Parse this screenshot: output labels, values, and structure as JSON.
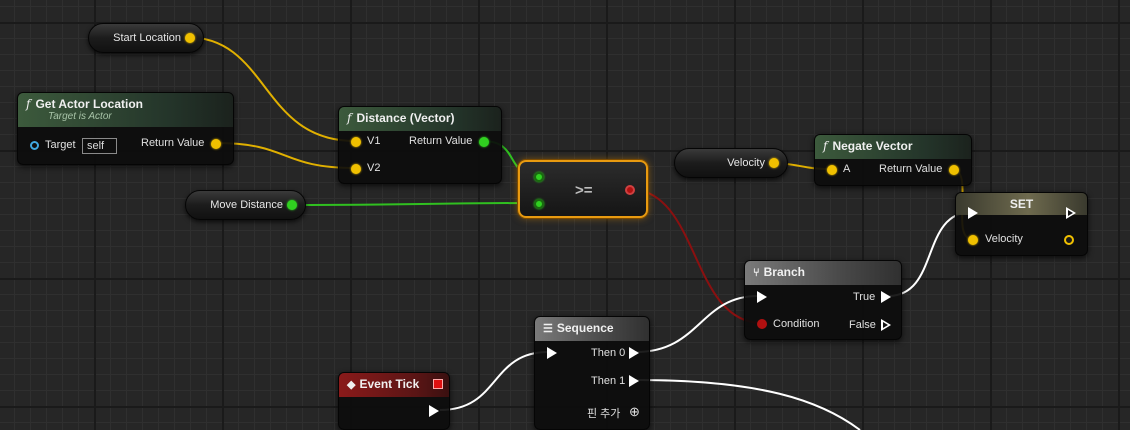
{
  "variables": {
    "start_location": "Start Location",
    "move_distance": "Move Distance",
    "velocity": "Velocity"
  },
  "get_actor_location": {
    "title": "Get Actor Location",
    "subtitle": "Target is Actor",
    "target_label": "Target",
    "target_value": "self",
    "return_label": "Return Value"
  },
  "distance": {
    "title": "Distance (Vector)",
    "v1": "V1",
    "v2": "V2",
    "return_label": "Return Value"
  },
  "compare": {
    "operator": ">="
  },
  "negate": {
    "title": "Negate Vector",
    "a": "A",
    "return_label": "Return Value"
  },
  "set_node": {
    "title": "SET",
    "velocity_label": "Velocity"
  },
  "branch": {
    "title": "Branch",
    "true_label": "True",
    "condition_label": "Condition",
    "false_label": "False"
  },
  "sequence": {
    "title": "Sequence",
    "then0": "Then 0",
    "then1": "Then 1",
    "add_pin": "핀 추가"
  },
  "event_tick": {
    "title": "Event Tick"
  },
  "colors": {
    "vector_pin": "#f0c000",
    "float_pin": "#30d020",
    "bool_pin": "#b01010",
    "exec_wire": "#ffffff",
    "selected_outline": "#e89a10"
  }
}
